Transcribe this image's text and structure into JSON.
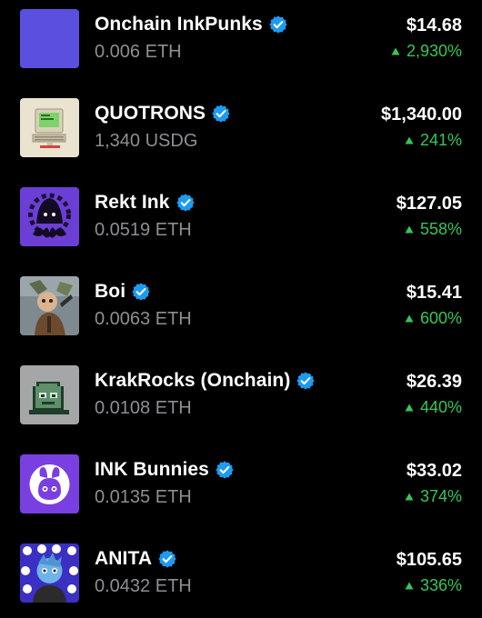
{
  "colors": {
    "background": "#000000",
    "verified_badge": "#1d9bf0",
    "positive": "#34c759",
    "secondary_text": "#8e8e93"
  },
  "collections": [
    {
      "name": "Onchain InkPunks",
      "verified": true,
      "floor": "0.006 ETH",
      "price": "$14.68",
      "change": "2,930%",
      "icon": "purple-square-thumbnail"
    },
    {
      "name": "QUOTRONS",
      "verified": true,
      "floor": "1,340 USDG",
      "price": "$1,340.00",
      "change": "241%",
      "icon": "retro-computer-thumbnail"
    },
    {
      "name": "Rekt Ink",
      "verified": true,
      "floor": "0.0519 ETH",
      "price": "$127.05",
      "change": "558%",
      "icon": "hooded-octopus-thumbnail"
    },
    {
      "name": "Boi",
      "verified": true,
      "floor": "0.0063 ETH",
      "price": "$15.41",
      "change": "600%",
      "icon": "character-art-thumbnail"
    },
    {
      "name": "KrakRocks (Onchain)",
      "verified": true,
      "floor": "0.0108 ETH",
      "price": "$26.39",
      "change": "440%",
      "icon": "pixel-rock-thumbnail"
    },
    {
      "name": "INK Bunnies",
      "verified": true,
      "floor": "0.0135 ETH",
      "price": "$33.02",
      "change": "374%",
      "icon": "bunny-logo-thumbnail"
    },
    {
      "name": "ANITA",
      "verified": true,
      "floor": "0.0432 ETH",
      "price": "$105.65",
      "change": "336%",
      "icon": "blue-character-thumbnail"
    }
  ]
}
